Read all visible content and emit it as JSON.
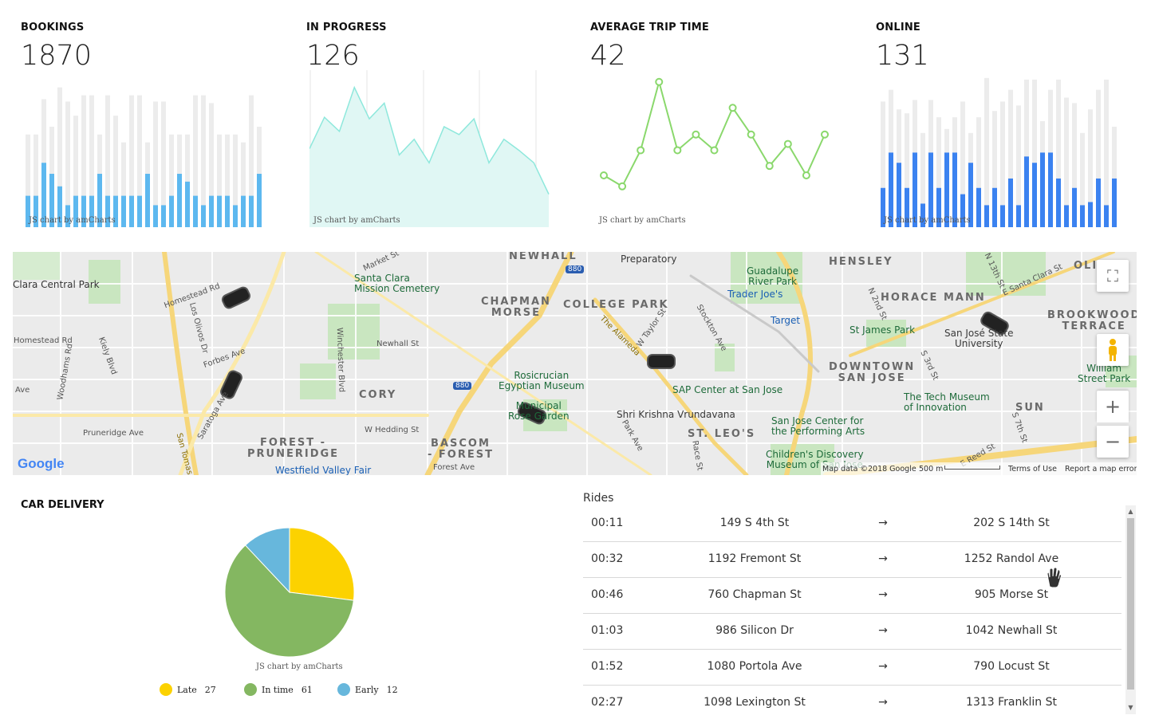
{
  "kpis": {
    "bookings": {
      "title": "BOOKINGS",
      "value": "1870",
      "credit": "JS chart by amCharts",
      "bars_total": [
        118,
        118,
        163,
        128,
        178,
        160,
        142,
        168,
        168,
        118,
        168,
        142,
        108,
        168,
        168,
        108,
        160,
        160,
        118,
        118,
        118,
        168,
        168,
        158,
        118,
        118,
        118,
        108,
        168,
        128
      ],
      "bars_value": [
        40,
        40,
        82,
        68,
        52,
        28,
        40,
        40,
        40,
        68,
        40,
        40,
        40,
        40,
        40,
        68,
        28,
        28,
        40,
        68,
        58,
        40,
        28,
        40,
        40,
        40,
        28,
        40,
        40,
        68,
        40,
        12
      ],
      "bar_color": "#5db8ef",
      "bg_color": "#ececec"
    },
    "in_progress": {
      "title": "IN PROGRESS",
      "value": "126",
      "credit": "JS chart by amCharts",
      "area_values": [
        100,
        140,
        122,
        178,
        138,
        158,
        92,
        112,
        82,
        128,
        118,
        138,
        82,
        112,
        98,
        82,
        42
      ],
      "line_color": "#8ee8dc",
      "fill_color": "#e0f7f4"
    },
    "avg_trip": {
      "title": "AVERAGE TRIP TIME",
      "value": "42",
      "credit": "JS chart by amCharts",
      "line_values": [
        66,
        52,
        98,
        185,
        98,
        118,
        98,
        152,
        118,
        78,
        106,
        66,
        118
      ],
      "line_color": "#8ad86c"
    },
    "online": {
      "title": "ONLINE",
      "value": "131",
      "credit": "JS chart by amCharts",
      "bars_total": [
        160,
        175,
        150,
        145,
        162,
        120,
        162,
        140,
        125,
        140,
        160,
        120,
        140,
        190,
        148,
        160,
        175,
        155,
        188,
        188,
        135,
        175,
        188,
        165,
        158,
        120,
        150,
        175,
        188,
        128
      ],
      "bars_value": [
        50,
        95,
        82,
        50,
        95,
        30,
        95,
        50,
        95,
        95,
        42,
        82,
        50,
        28,
        50,
        28,
        62,
        28,
        90,
        82,
        95,
        95,
        62,
        28,
        50,
        28,
        32,
        62,
        28,
        62
      ],
      "bar_color": "#3b82f0",
      "bg_color": "#ececec"
    }
  },
  "map": {
    "labels": {
      "clara_park": "Clara Central Park",
      "santa_clara_cemetery": "Santa Clara\nMission Cemetery",
      "newhall": "NEWHALL",
      "chapman_morse": "CHAPMAN\nMORSE",
      "college_park": "COLLEGE PARK",
      "preparatory": "Preparatory",
      "guadalupe": "Guadalupe\nRiver Park",
      "trader_joes": "Trader Joe's",
      "target": "Target",
      "hensley": "HENSLEY",
      "horace_mann": "HORACE MANN",
      "olin": "OLIN",
      "brookwood": "BROOKWOOD\nTERRACE",
      "st_james": "St James Park",
      "sjsu": "San José State\nUniversity",
      "william": "William\nStreet Park",
      "downtown": "DOWNTOWN\nSAN JOSE",
      "tech_museum": "The Tech Museum\nof Innovation",
      "sun": "SUN",
      "rosicrucian": "Rosicrucian\nEgyptian Museum",
      "rose_garden": "Municipal\nRose Garden",
      "cory": "CORY",
      "forest_pruneridge": "FOREST -\nPRUNERIDGE",
      "bascom_forest": "BASCOM\n- FOREST",
      "westfield": "Westfield Valley Fair",
      "sap_center": "SAP Center at San Jose",
      "shri_krishna": "Shri Krishna Vrundavana",
      "st_leos": "ST. LEO'S",
      "performing_arts": "San Jose Center for\nthe Performing Arts",
      "childrens": "Children's Discovery\nMuseum of San Jose",
      "homestead_rd": "Homestead Rd",
      "homestead_rd2": "Homestead Rd",
      "los_olivos": "Los Olivos Dr",
      "forbes": "Forbes Ave",
      "kiely": "Kiely Blvd",
      "woodhams": "Woodhams Rd",
      "winchester": "Winchester Blvd",
      "newhall_st": "Newhall St",
      "market": "Market St",
      "w_hedding": "W Hedding St",
      "saratoga": "Saratoga Ave",
      "pruneridge": "Pruneridge Ave",
      "forest_ave": "Forest Ave",
      "alameda": "The Alameda",
      "w_taylor": "W Taylor St",
      "stockton": "Stockton Ave",
      "park_ave": "Park Ave",
      "race_st": "Race St",
      "n_2nd": "N 2nd St",
      "s_3rd": "S 3rd St",
      "n_13th": "N 13th St",
      "s_7th": "S 7th St",
      "e_reed": "E Reed St",
      "e_santa_clara": "E Santa Clara St",
      "san_tomas": "San Tomas",
      "ave": "Ave",
      "i880": "880",
      "google": "Google"
    },
    "footer": {
      "map_data": "Map data ©2018 Google",
      "scale": "500 m",
      "terms": "Terms of Use",
      "report": "Report a map error"
    },
    "controls": {
      "fullscreen": "⛶",
      "zoom_in": "+",
      "zoom_out": "−"
    }
  },
  "delivery": {
    "title": "CAR DELIVERY",
    "credit": "JS chart by amCharts",
    "chart_data": {
      "type": "pie",
      "title": "CAR DELIVERY",
      "slices": [
        {
          "name": "Late",
          "value": 27,
          "color": "#fcd200"
        },
        {
          "name": "In time",
          "value": 61,
          "color": "#84b761"
        },
        {
          "name": "Early",
          "value": 12,
          "color": "#67b7dc"
        }
      ],
      "legend": "bottom"
    }
  },
  "rides": {
    "title": "Rides",
    "arrow": "→",
    "rows": [
      {
        "time": "00:11",
        "from": "149 S 4th St",
        "to": "202 S 14th St"
      },
      {
        "time": "00:32",
        "from": "1192 Fremont St",
        "to": "1252 Randol Ave"
      },
      {
        "time": "00:46",
        "from": "760 Chapman St",
        "to": "905 Morse St"
      },
      {
        "time": "01:03",
        "from": "986 Silicon Dr",
        "to": "1042 Newhall St"
      },
      {
        "time": "01:52",
        "from": "1080 Portola Ave",
        "to": "790 Locust St"
      },
      {
        "time": "02:27",
        "from": "1098 Lexington St",
        "to": "1313 Franklin St"
      }
    ]
  }
}
